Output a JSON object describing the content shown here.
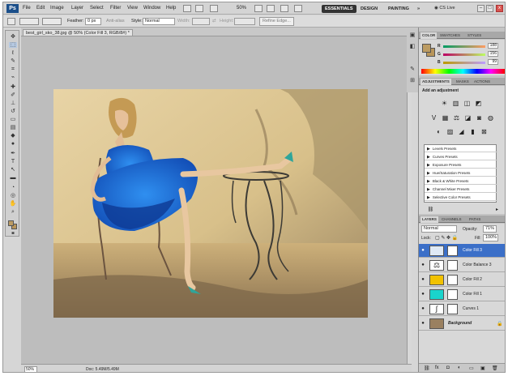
{
  "menubar": {
    "logo": "Ps",
    "items": [
      "File",
      "Edit",
      "Image",
      "Layer",
      "Select",
      "Filter",
      "View",
      "Window",
      "Help"
    ],
    "zoom": "50%",
    "workspaces": [
      "ESSENTIALS",
      "DESIGN",
      "PAINTING",
      "»"
    ],
    "cs_live": "CS Live",
    "win_buttons": [
      "–",
      "□",
      "x"
    ]
  },
  "options": {
    "feather_label": "Feather:",
    "feather_value": "0 px",
    "antialias_label": "Anti-alias",
    "style_label": "Style:",
    "style_value": "Normal",
    "width_label": "Width:",
    "height_label": "Height:",
    "refine_label": "Refine Edge..."
  },
  "document": {
    "tab_title": "best_girl_sko_38.jpg @ 50% (Color Fill 3, RGB/8#) *"
  },
  "status": {
    "zoom": "50%",
    "doc": "Doc: 5.49M/5.49M"
  },
  "color_panel": {
    "tabs": [
      "COLOR",
      "SWATCHES",
      "STYLES"
    ],
    "r_label": "R",
    "r_value": "188",
    "g_label": "G",
    "g_value": "156",
    "b_label": "B",
    "b_value": "99",
    "fg_color": "#bc9c63",
    "bg_color": "#b8955a"
  },
  "adjustments": {
    "tabs": [
      "ADJUSTMENTS",
      "MASKS",
      "ACTIONS"
    ],
    "title": "Add an adjustment",
    "presets": [
      "Levels Presets",
      "Curves Presets",
      "Exposure Presets",
      "Hue/Saturation Presets",
      "Black & White Presets",
      "Channel Mixer Presets",
      "Selective Color Presets"
    ]
  },
  "layers_panel": {
    "tabs": [
      "LAYERS",
      "CHANNELS",
      "PATHS"
    ],
    "blend_mode": "Normal",
    "opacity_label": "Opacity:",
    "opacity_value": "71%",
    "lock_label": "Lock:",
    "fill_label": "Fill:",
    "fill_value": "100%",
    "layers": [
      {
        "name": "Color Fill 3",
        "thumb_color": "#dfe9f5",
        "selected": true
      },
      {
        "name": "Color Balance 3",
        "thumb_color": "#ffffff",
        "selected": false
      },
      {
        "name": "Color Fill 2",
        "thumb_color": "#f2c200",
        "selected": false
      },
      {
        "name": "Color Fill 1",
        "thumb_color": "#1ad4cc",
        "selected": false
      },
      {
        "name": "Curves 1",
        "thumb_color": "#ffffff",
        "selected": false
      },
      {
        "name": "Background",
        "thumb_color": "#9a8060",
        "selected": false
      }
    ]
  },
  "colors": {
    "accent": "#3b6fc8",
    "canvas_bg": "#bdbdbd"
  }
}
